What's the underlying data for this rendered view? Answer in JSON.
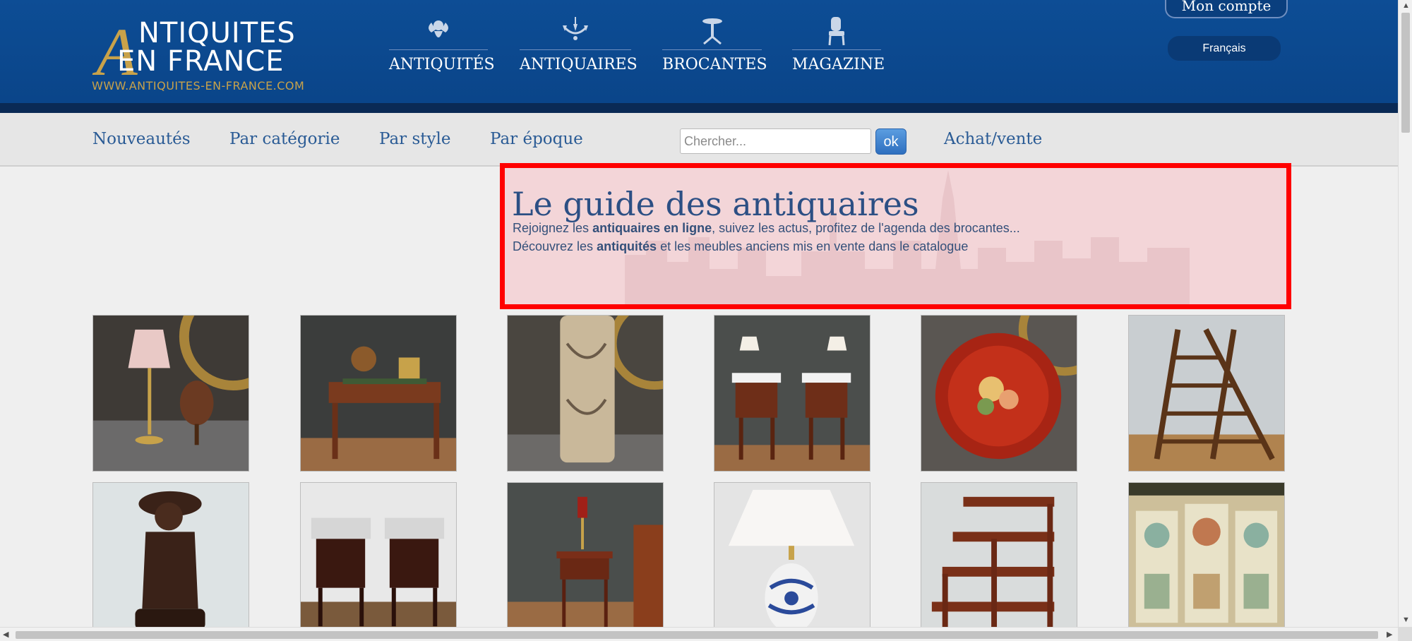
{
  "logo": {
    "line1": "NTIQUITES",
    "line2": "EN FRANCE",
    "big_letter": "A",
    "url": "WWW.ANTIQUITES-EN-FRANCE.COM"
  },
  "topnav": [
    {
      "label": "ANTIQUITÉS",
      "icon": "cherub-icon"
    },
    {
      "label": "ANTIQUAIRES",
      "icon": "chandelier-icon"
    },
    {
      "label": "BROCANTES",
      "icon": "gueridon-table-icon"
    },
    {
      "label": "MAGAZINE",
      "icon": "armchair-icon"
    }
  ],
  "account": {
    "label": "Mon compte"
  },
  "language": {
    "label": "Français"
  },
  "subnav": {
    "links": [
      "Nouveautés",
      "Par catégorie",
      "Par style",
      "Par époque"
    ],
    "search_placeholder": "Chercher...",
    "ok_label": "ok",
    "achat_vente": "Achat/vente"
  },
  "hero": {
    "title": "Le guide des antiquaires",
    "line1_pre": "Rejoignez les ",
    "line1_bold": "antiquaires en ligne",
    "line1_post": ", suivez les actus, profitez de l'agenda des brocantes...",
    "line2_pre": "Découvrez les ",
    "line2_bold": "antiquités",
    "line2_post": " et les meubles anciens mis en vente dans le catalogue"
  },
  "colors": {
    "header_blue": "#0d4d95",
    "gold": "#c8a24a",
    "link_blue": "#2a5b95",
    "highlight_border": "#ff0000"
  },
  "products": [
    {
      "name": "lamp-and-globe-photo"
    },
    {
      "name": "writing-desk-photo"
    },
    {
      "name": "umbrella-stand-photo"
    },
    {
      "name": "pair-of-nightstands-photo"
    },
    {
      "name": "red-tole-tray-photo"
    },
    {
      "name": "library-ladder-photo"
    },
    {
      "name": "bronze-statue-photo"
    },
    {
      "name": "marble-top-nightstands-photo"
    },
    {
      "name": "small-side-table-photo"
    },
    {
      "name": "blue-white-lamp-photo"
    },
    {
      "name": "step-library-stairs-photo"
    },
    {
      "name": "painted-boiserie-panels-photo"
    }
  ]
}
